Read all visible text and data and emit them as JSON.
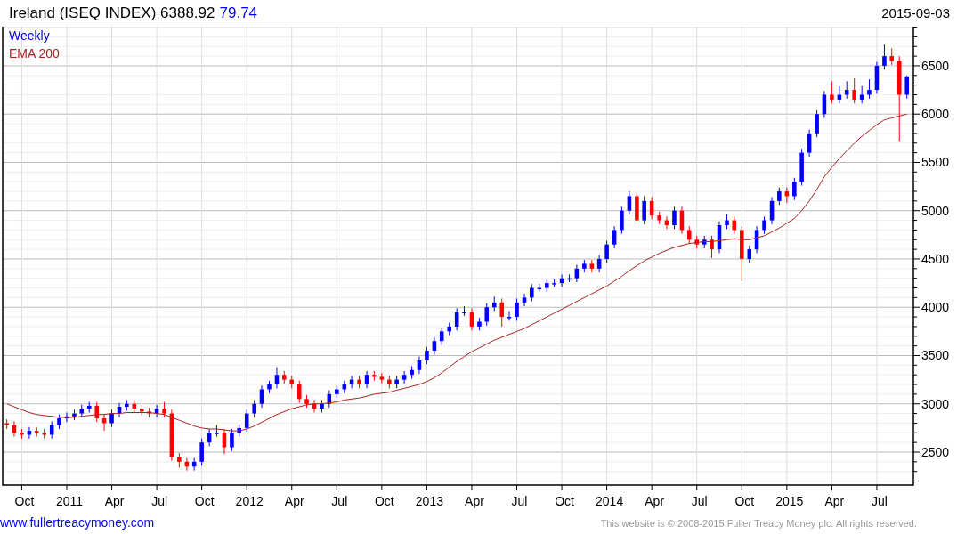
{
  "header": {
    "title": "Ireland (ISEQ INDEX) 6388.92",
    "change": "79.74",
    "date": "2015-09-03"
  },
  "chart": {
    "period_label": "Weekly",
    "chart_data": {
      "type": "candlestick",
      "grid": true,
      "xlim": [
        2010.644,
        2015.703
      ],
      "ylim": [
        2159,
        6905
      ],
      "x": [
        2010.667,
        2010.708,
        2010.75,
        2010.792,
        2010.833,
        2010.875,
        2010.917,
        2010.958,
        2011.0,
        2011.042,
        2011.083,
        2011.125,
        2011.167,
        2011.208,
        2011.25,
        2011.292,
        2011.333,
        2011.375,
        2011.417,
        2011.458,
        2011.5,
        2011.542,
        2011.583,
        2011.625,
        2011.667,
        2011.708,
        2011.75,
        2011.792,
        2011.833,
        2011.875,
        2011.917,
        2011.958,
        2012.0,
        2012.042,
        2012.083,
        2012.125,
        2012.167,
        2012.208,
        2012.25,
        2012.292,
        2012.333,
        2012.375,
        2012.417,
        2012.458,
        2012.5,
        2012.542,
        2012.583,
        2012.625,
        2012.667,
        2012.708,
        2012.75,
        2012.792,
        2012.833,
        2012.875,
        2012.917,
        2012.958,
        2013.0,
        2013.042,
        2013.083,
        2013.125,
        2013.167,
        2013.208,
        2013.25,
        2013.292,
        2013.333,
        2013.375,
        2013.417,
        2013.458,
        2013.5,
        2013.542,
        2013.583,
        2013.625,
        2013.667,
        2013.708,
        2013.75,
        2013.792,
        2013.833,
        2013.875,
        2013.917,
        2013.958,
        2014.0,
        2014.042,
        2014.083,
        2014.125,
        2014.167,
        2014.208,
        2014.25,
        2014.292,
        2014.333,
        2014.375,
        2014.417,
        2014.458,
        2014.5,
        2014.542,
        2014.583,
        2014.625,
        2014.667,
        2014.708,
        2014.75,
        2014.792,
        2014.833,
        2014.875,
        2014.917,
        2014.958,
        2015.0,
        2015.042,
        2015.083,
        2015.125,
        2015.167,
        2015.208,
        2015.25,
        2015.292,
        2015.333,
        2015.375,
        2015.417,
        2015.458,
        2015.5,
        2015.542,
        2015.583,
        2015.625,
        2015.667
      ],
      "ohlc": [
        [
          2800,
          2840,
          2740,
          2780
        ],
        [
          2780,
          2820,
          2660,
          2700
        ],
        [
          2700,
          2740,
          2640,
          2680
        ],
        [
          2680,
          2760,
          2640,
          2720
        ],
        [
          2720,
          2760,
          2660,
          2700
        ],
        [
          2700,
          2740,
          2640,
          2680
        ],
        [
          2680,
          2820,
          2640,
          2780
        ],
        [
          2780,
          2890,
          2740,
          2850
        ],
        [
          2850,
          2910,
          2810,
          2870
        ],
        [
          2870,
          2940,
          2830,
          2900
        ],
        [
          2900,
          2990,
          2860,
          2950
        ],
        [
          2950,
          3020,
          2910,
          2980
        ],
        [
          2980,
          3020,
          2810,
          2850
        ],
        [
          2850,
          2890,
          2720,
          2800
        ],
        [
          2800,
          2940,
          2760,
          2900
        ],
        [
          2900,
          3010,
          2860,
          2970
        ],
        [
          2970,
          3040,
          2930,
          3000
        ],
        [
          3000,
          3040,
          2910,
          2950
        ],
        [
          2950,
          2990,
          2880,
          2920
        ],
        [
          2920,
          2960,
          2860,
          2900
        ],
        [
          2900,
          2990,
          2860,
          2950
        ],
        [
          2950,
          3020,
          2860,
          2900
        ],
        [
          2900,
          2940,
          2410,
          2450
        ],
        [
          2450,
          2490,
          2340,
          2400
        ],
        [
          2400,
          2440,
          2310,
          2350
        ],
        [
          2350,
          2440,
          2310,
          2400
        ],
        [
          2400,
          2640,
          2360,
          2600
        ],
        [
          2600,
          2740,
          2560,
          2700
        ],
        [
          2700,
          2780,
          2660,
          2700
        ],
        [
          2700,
          2740,
          2480,
          2550
        ],
        [
          2550,
          2740,
          2510,
          2700
        ],
        [
          2700,
          2790,
          2660,
          2750
        ],
        [
          2750,
          2940,
          2710,
          2900
        ],
        [
          2900,
          3040,
          2860,
          3000
        ],
        [
          3000,
          3190,
          2960,
          3150
        ],
        [
          3150,
          3240,
          3110,
          3200
        ],
        [
          3200,
          3380,
          3160,
          3300
        ],
        [
          3300,
          3340,
          3210,
          3250
        ],
        [
          3250,
          3290,
          3160,
          3200
        ],
        [
          3200,
          3240,
          3010,
          3050
        ],
        [
          3050,
          3090,
          2960,
          3000
        ],
        [
          3000,
          3040,
          2910,
          2950
        ],
        [
          2950,
          3040,
          2910,
          3000
        ],
        [
          3000,
          3140,
          2960,
          3100
        ],
        [
          3100,
          3190,
          3060,
          3150
        ],
        [
          3150,
          3240,
          3110,
          3200
        ],
        [
          3200,
          3290,
          3160,
          3250
        ],
        [
          3250,
          3290,
          3160,
          3200
        ],
        [
          3200,
          3340,
          3160,
          3300
        ],
        [
          3300,
          3340,
          3240,
          3280
        ],
        [
          3280,
          3320,
          3210,
          3250
        ],
        [
          3250,
          3290,
          3160,
          3200
        ],
        [
          3200,
          3290,
          3160,
          3250
        ],
        [
          3250,
          3340,
          3210,
          3300
        ],
        [
          3300,
          3390,
          3260,
          3350
        ],
        [
          3350,
          3490,
          3310,
          3450
        ],
        [
          3450,
          3590,
          3410,
          3550
        ],
        [
          3550,
          3690,
          3510,
          3650
        ],
        [
          3650,
          3790,
          3610,
          3750
        ],
        [
          3750,
          3840,
          3710,
          3800
        ],
        [
          3800,
          3990,
          3760,
          3950
        ],
        [
          3950,
          4010,
          3910,
          3950
        ],
        [
          3950,
          3990,
          3760,
          3800
        ],
        [
          3800,
          3890,
          3760,
          3850
        ],
        [
          3850,
          4040,
          3810,
          4000
        ],
        [
          4000,
          4110,
          3960,
          4050
        ],
        [
          4050,
          4090,
          3800,
          3900
        ],
        [
          3900,
          3960,
          3860,
          3900
        ],
        [
          3900,
          4090,
          3860,
          4050
        ],
        [
          4050,
          4140,
          4010,
          4100
        ],
        [
          4100,
          4240,
          4060,
          4200
        ],
        [
          4200,
          4240,
          4160,
          4200
        ],
        [
          4200,
          4290,
          4160,
          4250
        ],
        [
          4250,
          4290,
          4210,
          4250
        ],
        [
          4250,
          4340,
          4210,
          4300
        ],
        [
          4300,
          4340,
          4260,
          4300
        ],
        [
          4300,
          4440,
          4260,
          4400
        ],
        [
          4400,
          4490,
          4360,
          4450
        ],
        [
          4450,
          4490,
          4360,
          4400
        ],
        [
          4400,
          4540,
          4360,
          4500
        ],
        [
          4500,
          4690,
          4460,
          4650
        ],
        [
          4650,
          4840,
          4610,
          4800
        ],
        [
          4800,
          5040,
          4760,
          5000
        ],
        [
          5000,
          5200,
          4960,
          5150
        ],
        [
          5150,
          5190,
          4860,
          4900
        ],
        [
          4900,
          5150,
          4860,
          5100
        ],
        [
          5100,
          5140,
          4910,
          4950
        ],
        [
          4950,
          4990,
          4860,
          4900
        ],
        [
          4900,
          4940,
          4810,
          4850
        ],
        [
          4850,
          5040,
          4810,
          5000
        ],
        [
          5000,
          5040,
          4760,
          4800
        ],
        [
          4800,
          4840,
          4660,
          4700
        ],
        [
          4700,
          4740,
          4610,
          4650
        ],
        [
          4650,
          4740,
          4610,
          4700
        ],
        [
          4700,
          4740,
          4510,
          4600
        ],
        [
          4600,
          4890,
          4560,
          4850
        ],
        [
          4850,
          4960,
          4810,
          4900
        ],
        [
          4900,
          4940,
          4760,
          4800
        ],
        [
          4800,
          4840,
          4270,
          4500
        ],
        [
          4500,
          4640,
          4460,
          4600
        ],
        [
          4600,
          4840,
          4560,
          4800
        ],
        [
          4800,
          4940,
          4760,
          4900
        ],
        [
          4900,
          5140,
          4860,
          5100
        ],
        [
          5100,
          5240,
          5060,
          5200
        ],
        [
          5200,
          5240,
          5080,
          5150
        ],
        [
          5150,
          5340,
          5110,
          5300
        ],
        [
          5300,
          5640,
          5260,
          5600
        ],
        [
          5600,
          5840,
          5560,
          5800
        ],
        [
          5800,
          6040,
          5760,
          6000
        ],
        [
          6000,
          6240,
          5960,
          6200
        ],
        [
          6200,
          6340,
          6110,
          6150
        ],
        [
          6150,
          6290,
          6110,
          6200
        ],
        [
          6200,
          6340,
          6160,
          6250
        ],
        [
          6250,
          6370,
          6110,
          6150
        ],
        [
          6150,
          6290,
          6110,
          6200
        ],
        [
          6200,
          6360,
          6160,
          6250
        ],
        [
          6250,
          6540,
          6210,
          6500
        ],
        [
          6500,
          6720,
          6460,
          6600
        ],
        [
          6600,
          6680,
          6510,
          6550
        ],
        [
          6550,
          6600,
          5720,
          6200
        ],
        [
          6200,
          6400,
          6160,
          6390
        ]
      ],
      "series": [
        {
          "name": "EMA 200",
          "type": "line",
          "color": "#aa2222",
          "values": [
            3000,
            2970,
            2940,
            2910,
            2890,
            2880,
            2870,
            2860,
            2860,
            2860,
            2870,
            2880,
            2890,
            2890,
            2900,
            2900,
            2910,
            2910,
            2910,
            2910,
            2900,
            2890,
            2860,
            2830,
            2800,
            2770,
            2750,
            2740,
            2740,
            2730,
            2720,
            2720,
            2740,
            2770,
            2810,
            2850,
            2890,
            2920,
            2950,
            2970,
            2990,
            3000,
            3000,
            3010,
            3020,
            3040,
            3050,
            3060,
            3080,
            3100,
            3110,
            3120,
            3140,
            3160,
            3180,
            3200,
            3230,
            3270,
            3320,
            3380,
            3440,
            3490,
            3540,
            3580,
            3620,
            3660,
            3690,
            3720,
            3750,
            3780,
            3820,
            3860,
            3900,
            3940,
            3980,
            4020,
            4060,
            4100,
            4140,
            4180,
            4220,
            4270,
            4320,
            4380,
            4430,
            4480,
            4520,
            4560,
            4590,
            4620,
            4640,
            4660,
            4670,
            4680,
            4680,
            4690,
            4700,
            4710,
            4700,
            4700,
            4720,
            4740,
            4780,
            4820,
            4870,
            4920,
            5000,
            5100,
            5220,
            5350,
            5450,
            5540,
            5620,
            5700,
            5770,
            5830,
            5890,
            5940,
            5960,
            5980,
            6000
          ]
        }
      ],
      "xticks": [
        {
          "value": 2010.75,
          "label": "Oct"
        },
        {
          "value": 2011,
          "label": "2011"
        },
        {
          "value": 2011.25,
          "label": "Apr"
        },
        {
          "value": 2011.5,
          "label": "Jul"
        },
        {
          "value": 2011.75,
          "label": "Oct"
        },
        {
          "value": 2012,
          "label": "2012"
        },
        {
          "value": 2012.25,
          "label": "Apr"
        },
        {
          "value": 2012.5,
          "label": "Jul"
        },
        {
          "value": 2012.75,
          "label": "Oct"
        },
        {
          "value": 2013,
          "label": "2013"
        },
        {
          "value": 2013.25,
          "label": "Apr"
        },
        {
          "value": 2013.5,
          "label": "Jul"
        },
        {
          "value": 2013.75,
          "label": "Oct"
        },
        {
          "value": 2014,
          "label": "2014"
        },
        {
          "value": 2014.25,
          "label": "Apr"
        },
        {
          "value": 2014.5,
          "label": "Jul"
        },
        {
          "value": 2014.75,
          "label": "Oct"
        },
        {
          "value": 2015,
          "label": "2015"
        },
        {
          "value": 2015.25,
          "label": "Apr"
        },
        {
          "value": 2015.5,
          "label": "Jul"
        }
      ],
      "yticks": [
        2500,
        3000,
        3500,
        4000,
        4500,
        5000,
        5500,
        6000,
        6500
      ]
    }
  },
  "footer": {
    "link": "www.fullertreacymoney.com",
    "copyright": "This website is © 2008-2015 Fuller Treacy Money plc. All rights reserved."
  }
}
